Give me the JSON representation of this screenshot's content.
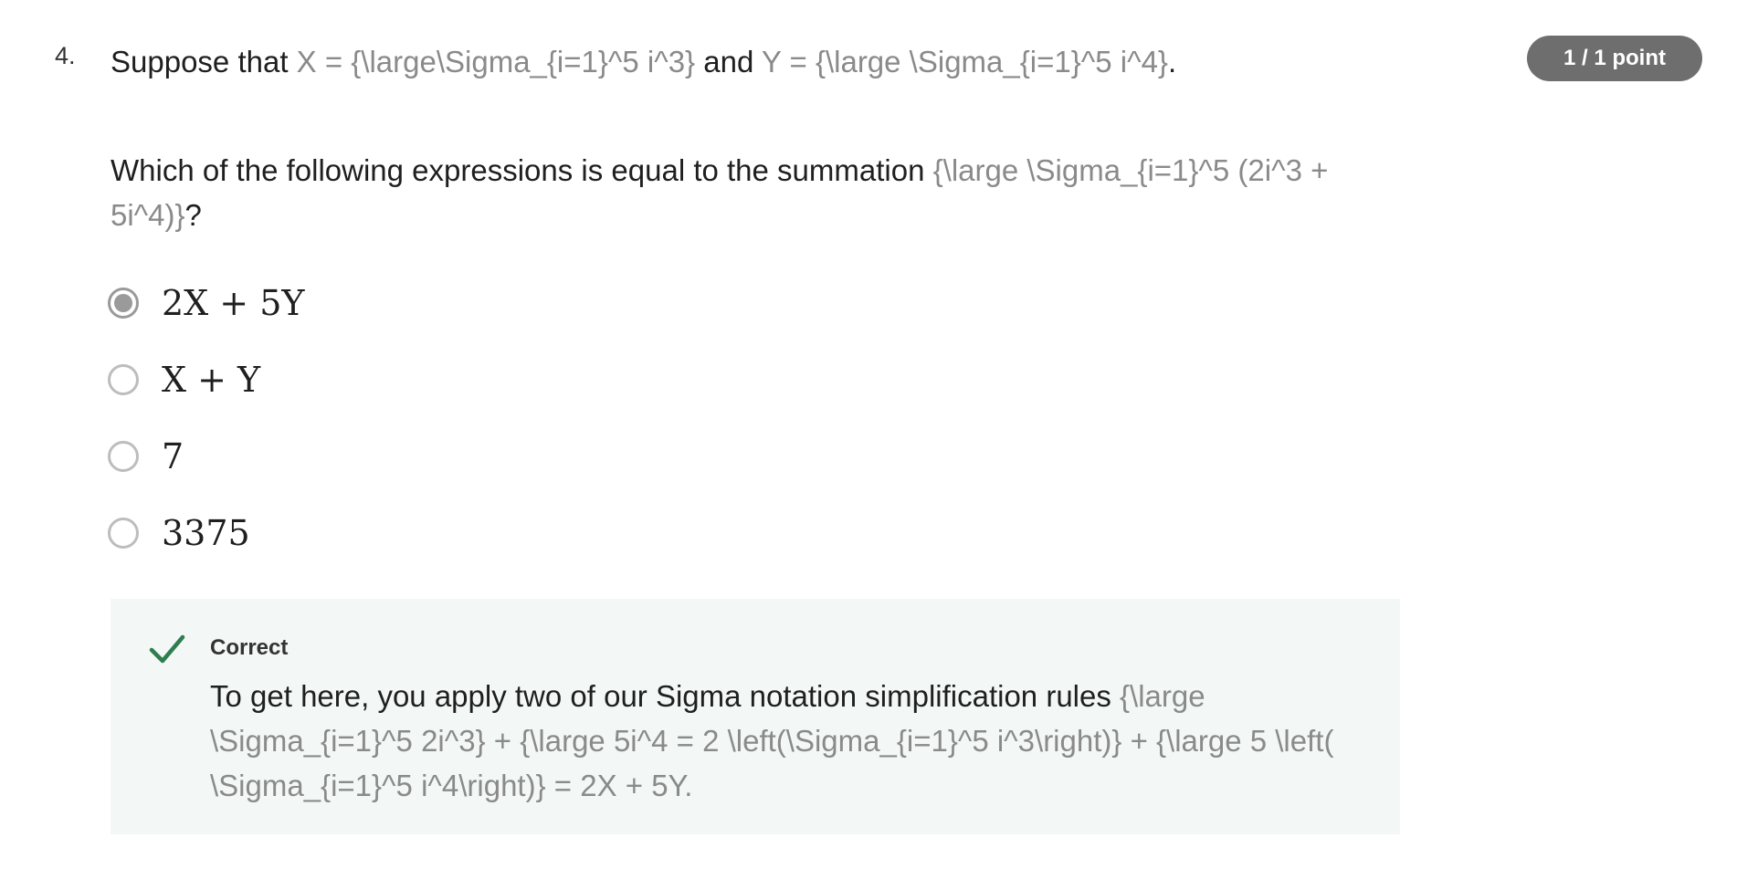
{
  "question": {
    "number": "4.",
    "points": "1 / 1 point",
    "prompt": {
      "t1": "Suppose that ",
      "x_expr": "X = {\\large\\Sigma_{i=1}^5 i^3}",
      "t2": " and ",
      "y_expr": "Y = {\\large \\Sigma_{i=1}^5 i^4}",
      "t3": "."
    },
    "which": {
      "t1": "Which of the following expressions is equal to the summation ",
      "expr": "{\\large \\Sigma_{i=1}^5 (2i^3 + 5i^4)}",
      "t2": "?"
    },
    "options": [
      {
        "label": "2X + 5Y",
        "selected": true
      },
      {
        "label": "X + Y",
        "selected": false
      },
      {
        "label": "7",
        "selected": false
      },
      {
        "label": "3375",
        "selected": false
      }
    ]
  },
  "feedback": {
    "title": "Correct",
    "t1": "To get here, you apply two of our Sigma notation simplification rules ",
    "expr": "{\\large \\Sigma_{i=1}^5 2i^3} + {\\large 5i^4 = 2 \\left(\\Sigma_{i=1}^5 i^3\\right)} + {\\large 5 \\left( \\Sigma_{i=1}^5 i^4\\right)} = 2X + 5Y.",
    "check_icon": "checkmark-icon",
    "check_color": "#2e7d4f"
  },
  "colors": {
    "badge_bg": "#6e6e6e",
    "feedback_bg": "#f3f8f6",
    "latex_text": "#8a8a8a"
  }
}
